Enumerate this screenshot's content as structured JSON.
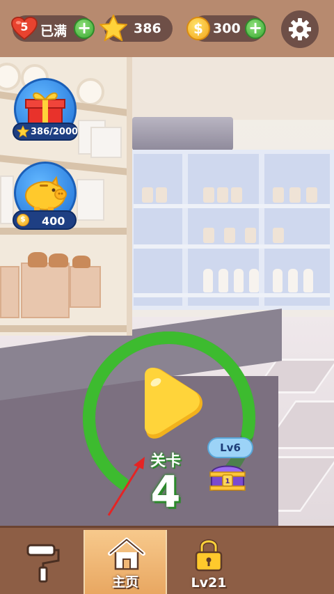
{
  "top_bar": {
    "lives": {
      "count": "5",
      "status": "已满",
      "icon": "heart-icon"
    },
    "stars": {
      "value": "386",
      "icon": "star-icon"
    },
    "coins": {
      "value": "300",
      "icon": "coin-icon",
      "coin_symbol": "$"
    },
    "settings": {
      "icon": "gear-icon"
    }
  },
  "side_widgets": {
    "gift": {
      "icon": "gift-box-icon",
      "progress": "386/2000"
    },
    "piggy_bank": {
      "icon": "piggy-bank-icon",
      "value": "400",
      "coin_symbol": "$"
    }
  },
  "level": {
    "label": "关卡",
    "number": "4",
    "progress_fraction": 0.85,
    "chest_label": "Lv6",
    "chest_badge": "1"
  },
  "bottom_nav": {
    "tabs": [
      {
        "name": "decorate",
        "icon": "paint-roller-icon",
        "label": ""
      },
      {
        "name": "home",
        "icon": "home-icon",
        "label": "主页",
        "active": true
      },
      {
        "name": "locked",
        "icon": "lock-icon",
        "label": "Lv21"
      }
    ]
  },
  "colors": {
    "ring_green": "#3dbb2f",
    "ring_dark": "#2e8a2a",
    "play_yellow": "#ffd43a",
    "nav_brown": "#8d5e45",
    "nav_active": "#f1b877",
    "topbar_brown": "#b78a6f"
  }
}
